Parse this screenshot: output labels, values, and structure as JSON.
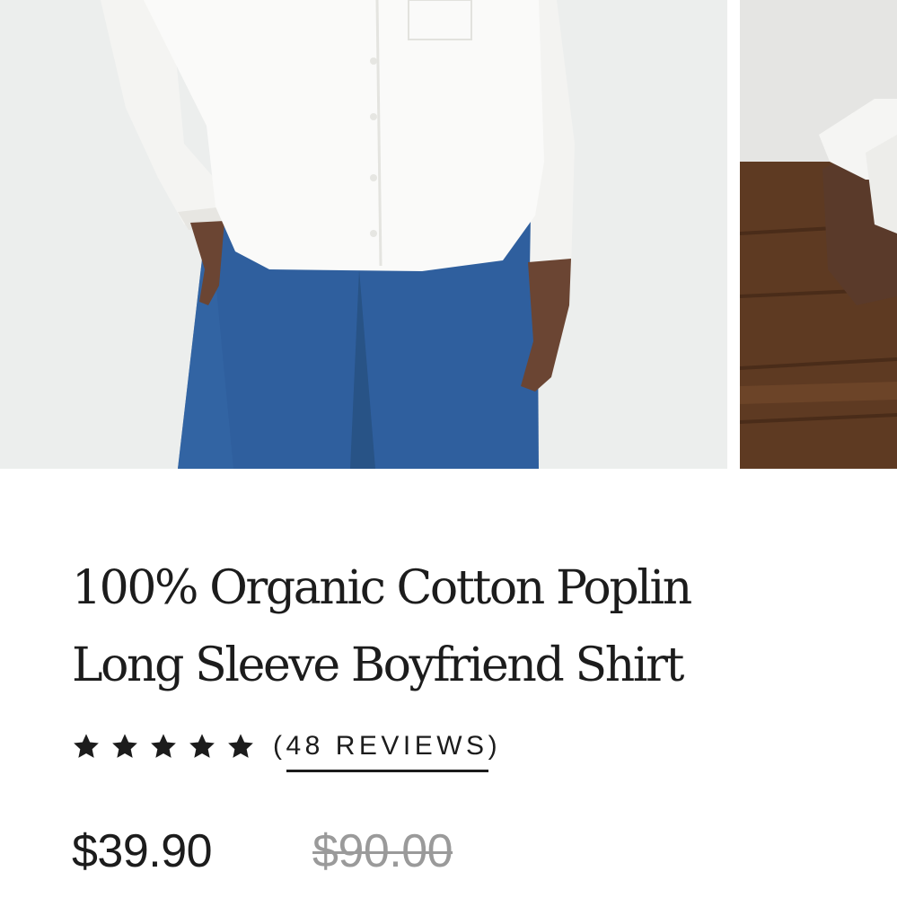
{
  "product": {
    "title_line1": "100% Organic Cotton Poplin",
    "title_line2": "Long Sleeve Boyfriend Shirt",
    "rating": 5,
    "rating_max": 5,
    "reviews": {
      "open_paren": "(",
      "label": "48 REVIEWS",
      "close_paren": ")"
    },
    "price_sale": "$39.90",
    "price_original": "$90.00"
  },
  "gallery": {
    "images": [
      {
        "alt": "model-white-shirt-blue-jeans"
      },
      {
        "alt": "shirt-cuff-wood-table"
      }
    ]
  },
  "colors": {
    "text": "#1c1c1c",
    "muted": "#9a9a9a",
    "background": "#ffffff"
  }
}
